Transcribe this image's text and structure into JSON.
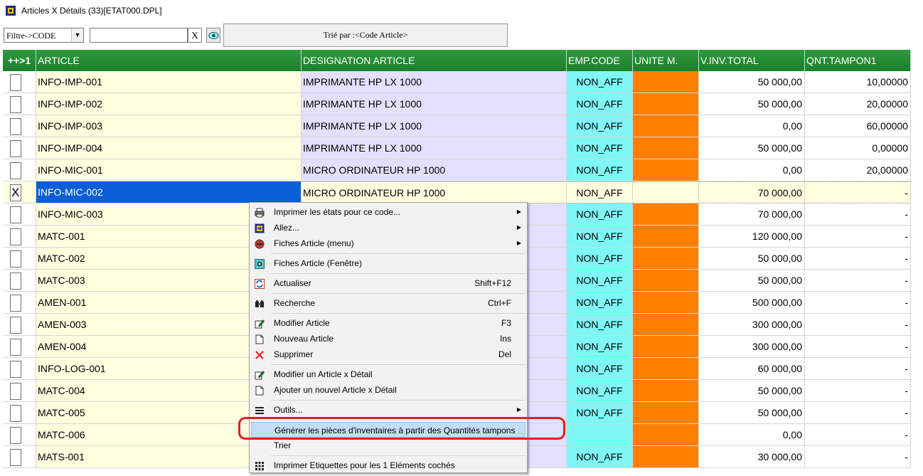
{
  "window": {
    "title": "Articles X Détails (33)[ETAT000.DPL]"
  },
  "toolbar": {
    "filter_value": "Filtre->CODE",
    "search_value": "",
    "clear_label": "X",
    "sort_label": "Trié par :<Code Article>"
  },
  "grid": {
    "headers": {
      "check": "++>1",
      "article": "ARTICLE",
      "designation": "DESIGNATION ARTICLE",
      "emp_code": "EMP.CODE",
      "unite": "UNITE M.",
      "inv_total": "V.INV.TOTAL",
      "qnt_tampon": "QNT.TAMPON1"
    },
    "rows": [
      {
        "checked": false,
        "article": "INFO-IMP-001",
        "designation": "IMPRIMANTE HP LX 1000",
        "emp_code": "NON_AFF",
        "inv_total": "50 000,00",
        "qnt_tampon": "10,00000"
      },
      {
        "checked": false,
        "article": "INFO-IMP-002",
        "designation": "IMPRIMANTE HP LX 1000",
        "emp_code": "NON_AFF",
        "inv_total": "50 000,00",
        "qnt_tampon": "20,00000"
      },
      {
        "checked": false,
        "article": "INFO-IMP-003",
        "designation": "IMPRIMANTE HP LX 1000",
        "emp_code": "NON_AFF",
        "inv_total": "0,00",
        "qnt_tampon": "60,00000"
      },
      {
        "checked": false,
        "article": "INFO-IMP-004",
        "designation": "IMPRIMANTE HP LX 1000",
        "emp_code": "NON_AFF",
        "inv_total": "50 000,00",
        "qnt_tampon": "0,00000"
      },
      {
        "checked": false,
        "article": "INFO-MIC-001",
        "designation": "MICRO ORDINATEUR HP 1000",
        "emp_code": "NON_AFF",
        "inv_total": "0,00",
        "qnt_tampon": "20,00000"
      },
      {
        "checked": true,
        "selected": true,
        "article": "INFO-MIC-002",
        "designation": "MICRO ORDINATEUR HP 1000",
        "emp_code": "NON_AFF",
        "inv_total": "70 000,00",
        "qnt_tampon": "-"
      },
      {
        "checked": false,
        "article": "INFO-MIC-003",
        "designation": "",
        "emp_code": "NON_AFF",
        "inv_total": "70 000,00",
        "qnt_tampon": "-"
      },
      {
        "checked": false,
        "article": "MATC-001",
        "designation": "",
        "emp_code": "NON_AFF",
        "inv_total": "120 000,00",
        "qnt_tampon": "-"
      },
      {
        "checked": false,
        "article": "MATC-002",
        "designation": "",
        "emp_code": "NON_AFF",
        "inv_total": "50 000,00",
        "qnt_tampon": "-"
      },
      {
        "checked": false,
        "article": "MATC-003",
        "designation": "",
        "emp_code": "NON_AFF",
        "inv_total": "50 000,00",
        "qnt_tampon": "-"
      },
      {
        "checked": false,
        "article": "AMEN-001",
        "designation": "",
        "emp_code": "NON_AFF",
        "inv_total": "500 000,00",
        "qnt_tampon": "-"
      },
      {
        "checked": false,
        "article": "AMEN-003",
        "designation": "",
        "emp_code": "NON_AFF",
        "inv_total": "300 000,00",
        "qnt_tampon": "-"
      },
      {
        "checked": false,
        "article": "AMEN-004",
        "designation": "",
        "emp_code": "NON_AFF",
        "inv_total": "300 000,00",
        "qnt_tampon": "-"
      },
      {
        "checked": false,
        "article": "INFO-LOG-001",
        "designation": "",
        "emp_code": "NON_AFF",
        "inv_total": "60 000,00",
        "qnt_tampon": "-"
      },
      {
        "checked": false,
        "article": "MATC-004",
        "designation": "",
        "emp_code": "NON_AFF",
        "inv_total": "50 000,00",
        "qnt_tampon": "-"
      },
      {
        "checked": false,
        "article": "MATC-005",
        "designation": "",
        "emp_code": "NON_AFF",
        "inv_total": "50 000,00",
        "qnt_tampon": "-"
      },
      {
        "checked": false,
        "article": "MATC-006",
        "designation": "",
        "emp_code": "",
        "inv_total": "0,00",
        "qnt_tampon": "-"
      },
      {
        "checked": false,
        "article": "MATS-001",
        "designation": "",
        "emp_code": "NON_AFF",
        "inv_total": "30 000,00",
        "qnt_tampon": "-"
      }
    ]
  },
  "context_menu": {
    "items": [
      {
        "label": "Imprimer les états pour ce code...",
        "shortcut": "",
        "icon": "printer-icon",
        "submenu": true
      },
      {
        "label": "Allez...",
        "shortcut": "",
        "icon": "goto-icon",
        "submenu": true
      },
      {
        "label": "Fiches Article (menu)",
        "shortcut": "",
        "icon": "record-menu-icon",
        "submenu": true
      },
      {
        "label": "Fiches Article (Fenêtre)",
        "shortcut": "",
        "icon": "record-window-icon",
        "submenu": false
      },
      {
        "label": "Actualiser",
        "shortcut": "Shift+F12",
        "icon": "refresh-icon",
        "submenu": false
      },
      {
        "label": "Recherche",
        "shortcut": "Ctrl+F",
        "icon": "binoculars-icon",
        "submenu": false
      },
      {
        "label": "Modifier Article",
        "shortcut": "F3",
        "icon": "edit-icon",
        "submenu": false
      },
      {
        "label": "Nouveau Article",
        "shortcut": "Ins",
        "icon": "new-document-icon",
        "submenu": false
      },
      {
        "label": "Supprimer",
        "shortcut": "Del",
        "icon": "delete-icon",
        "submenu": false
      },
      {
        "label": "Modifier un Article x Détail",
        "shortcut": "",
        "icon": "edit-icon",
        "submenu": false
      },
      {
        "label": "Ajouter un nouvel Article x Détail",
        "shortcut": "",
        "icon": "new-document-icon",
        "submenu": false
      },
      {
        "label": "Outils...",
        "shortcut": "",
        "icon": "tools-icon",
        "submenu": true
      },
      {
        "label": "Générer les pièces d'inventaires à partir des Quantités tampons",
        "shortcut": "",
        "icon": "",
        "submenu": false,
        "highlighted": true
      },
      {
        "label": "Trier",
        "shortcut": "",
        "icon": "",
        "submenu": false
      },
      {
        "label": "Imprimer Etiquettes pour les 1 Eléments cochés",
        "shortcut": "",
        "icon": "grid-icon",
        "submenu": false
      }
    ]
  },
  "colors": {
    "header_green": "#1c7f2c",
    "article_bg": "#ffffe0",
    "designation_bg": "#e2e0ff",
    "emp_bg": "#7ff7f7",
    "unite_bg": "#ff8000",
    "selection_blue": "#0a5fd6",
    "annotation_red": "#e02020"
  }
}
